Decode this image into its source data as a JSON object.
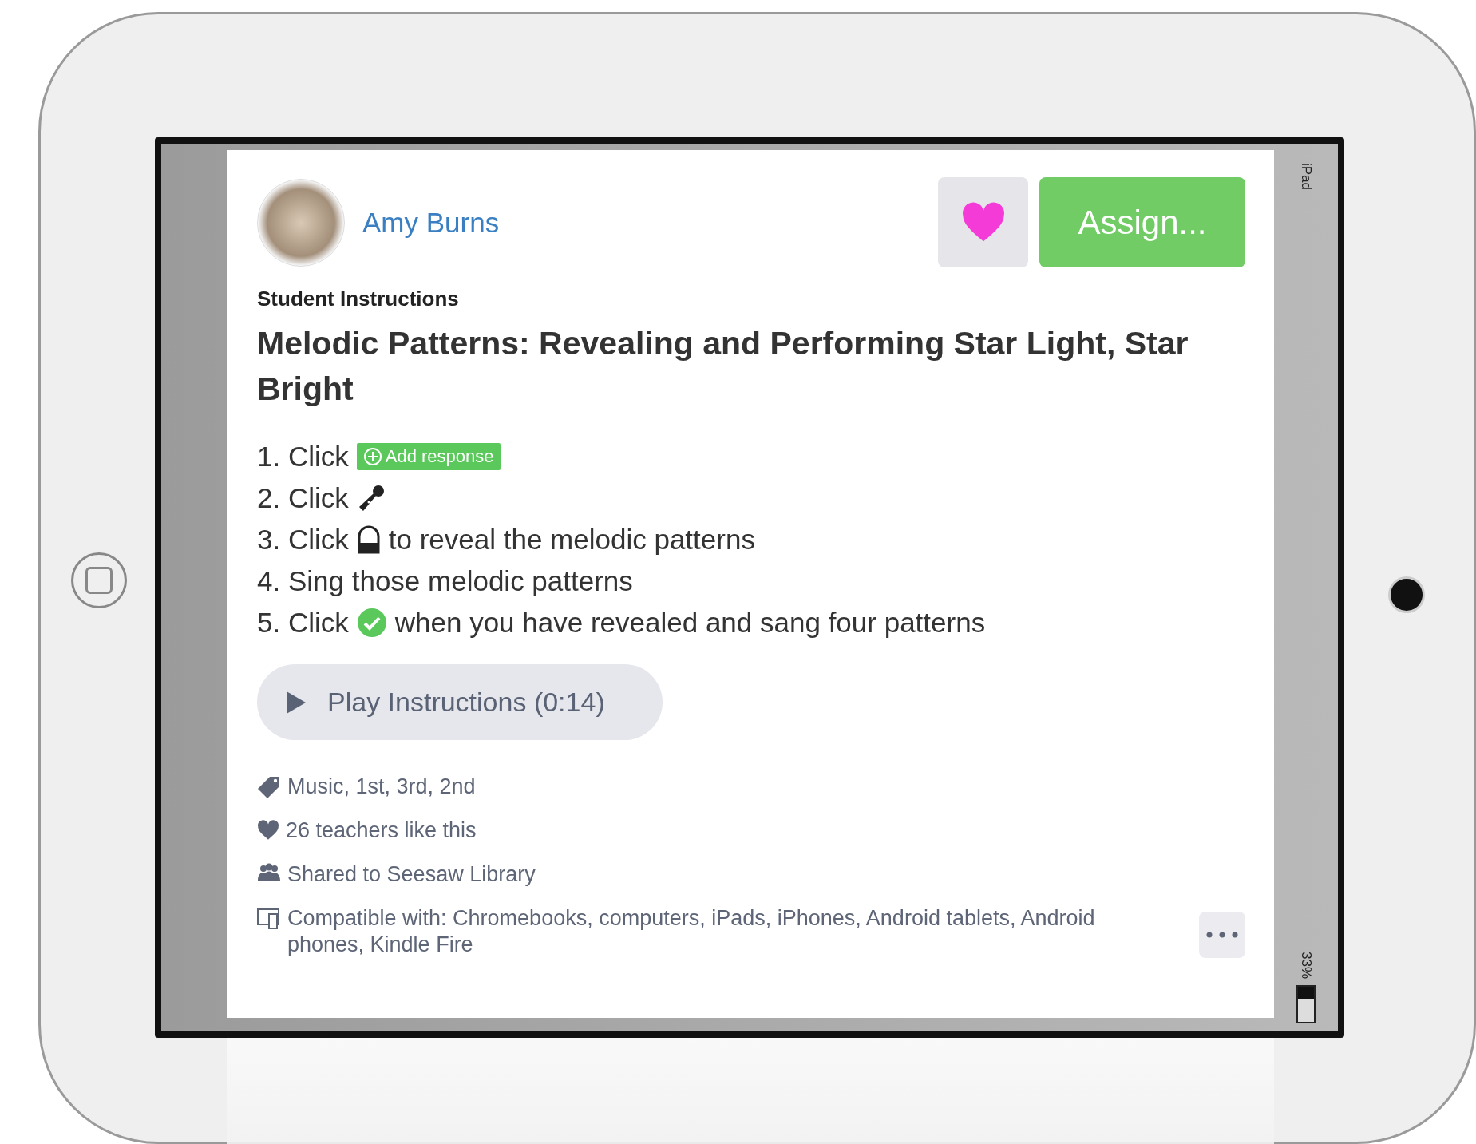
{
  "author": {
    "name": "Amy Burns"
  },
  "assign_button": "Assign...",
  "section_label": "Student Instructions",
  "title": "Melodic Patterns: Revealing and Performing Star Light, Star Bright",
  "steps": [
    {
      "kind": "add-response",
      "text": "1. Click",
      "chip": "Add response"
    },
    {
      "kind": "mic",
      "text": "2. Click"
    },
    {
      "kind": "lock",
      "text": "3. Click",
      "after": "to reveal the melodic patterns"
    },
    {
      "kind": "plain",
      "text": "4. Sing those melodic patterns"
    },
    {
      "kind": "check",
      "text": "5. Click",
      "after": "when you have revealed and sang four patterns"
    }
  ],
  "play_button": "Play Instructions (0:14)",
  "meta": [
    {
      "kind": "tags",
      "text": "Music, 1st, 3rd, 2nd"
    },
    {
      "kind": "likes",
      "text": "26 teachers like this"
    },
    {
      "kind": "shared",
      "text": "Shared to Seesaw Library"
    },
    {
      "kind": "devices",
      "text": "Compatible with: Chromebooks, computers, iPads, iPhones, Android tablets, Android phones, Kindle Fire"
    }
  ],
  "device_status": {
    "model": "iPad",
    "battery": "33%"
  }
}
